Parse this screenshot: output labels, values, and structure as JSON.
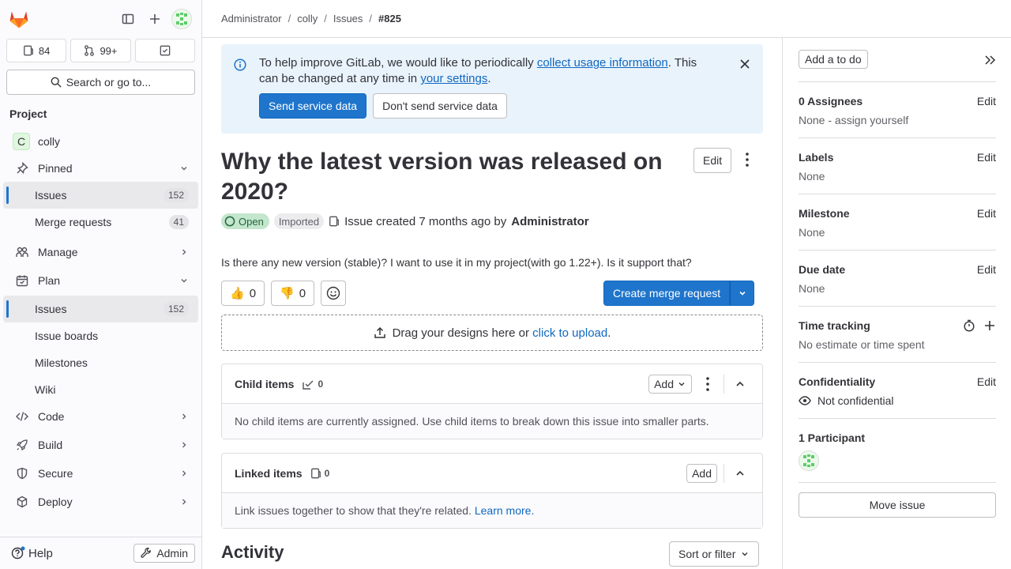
{
  "sidebar": {
    "counts": {
      "issues": "84",
      "merge_requests": "99+"
    },
    "search_label": "Search or go to...",
    "section_title": "Project",
    "project": {
      "initial": "C",
      "name": "colly"
    },
    "pinned_label": "Pinned",
    "pinned_issues": {
      "label": "Issues",
      "count": "152"
    },
    "pinned_mrs": {
      "label": "Merge requests",
      "count": "41"
    },
    "manage_label": "Manage",
    "plan_label": "Plan",
    "plan_issues": {
      "label": "Issues",
      "count": "152"
    },
    "issue_boards": "Issue boards",
    "milestones": "Milestones",
    "wiki": "Wiki",
    "code": "Code",
    "build": "Build",
    "secure": "Secure",
    "deploy": "Deploy",
    "help": "Help",
    "admin": "Admin"
  },
  "breadcrumb": [
    "Administrator",
    "colly",
    "Issues",
    "#825"
  ],
  "alert": {
    "text1": "To help improve GitLab, we would like to periodically ",
    "link1": "collect usage information",
    "text2": ". This can be changed at any time in ",
    "link2": "your settings",
    "text3": ".",
    "send": "Send service data",
    "dont": "Don't send service data"
  },
  "issue": {
    "title": "Why the latest version was released on 2020?",
    "edit": "Edit",
    "status": "Open",
    "imported": "Imported",
    "created": "Issue created 7 months ago by",
    "author": "Administrator",
    "description": "Is there any new version (stable)? I want to use it in my project(with go 1.22+). Is it support that?",
    "thumbs_up": "0",
    "thumbs_down": "0",
    "create_mr": "Create merge request",
    "upload_text": "Drag your designs here or ",
    "upload_link": "click to upload",
    "upload_end": "."
  },
  "child_items": {
    "title": "Child items",
    "count": "0",
    "add": "Add",
    "empty": "No child items are currently assigned. Use child items to break down this issue into smaller parts."
  },
  "linked_items": {
    "title": "Linked items",
    "count": "0",
    "add": "Add",
    "empty": "Link issues together to show that they're related. ",
    "learn_more": "Learn more."
  },
  "activity": {
    "title": "Activity",
    "sort": "Sort or filter"
  },
  "right": {
    "todo": "Add a to do",
    "assignees": {
      "title": "0 Assignees",
      "edit": "Edit",
      "value": "None - assign yourself"
    },
    "labels": {
      "title": "Labels",
      "edit": "Edit",
      "value": "None"
    },
    "milestone": {
      "title": "Milestone",
      "edit": "Edit",
      "value": "None"
    },
    "due_date": {
      "title": "Due date",
      "edit": "Edit",
      "value": "None"
    },
    "time_tracking": {
      "title": "Time tracking",
      "value": "No estimate or time spent"
    },
    "confidentiality": {
      "title": "Confidentiality",
      "edit": "Edit",
      "value": "Not confidential"
    },
    "participants": {
      "title": "1 Participant"
    },
    "move": "Move issue"
  }
}
